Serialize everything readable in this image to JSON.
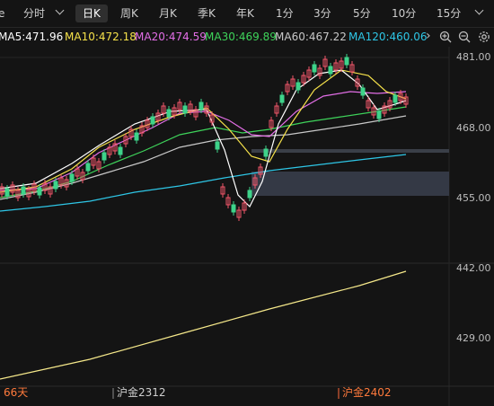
{
  "tabs": {
    "partial": "e",
    "items": [
      "分时",
      "日K",
      "周K",
      "月K",
      "季K",
      "年K",
      "1分",
      "3分",
      "5分",
      "10分",
      "15分"
    ],
    "active": "日K"
  },
  "legend": [
    {
      "label": "MA5:471.96",
      "color": "#ffffff"
    },
    {
      "label": "MA10:472.18",
      "color": "#f5e14a"
    },
    {
      "label": "MA20:474.59",
      "color": "#e26ee6"
    },
    {
      "label": "MA30:469.89",
      "color": "#3ed35a"
    },
    {
      "label": "MA60:467.22",
      "color": "#c8c8c8"
    },
    {
      "label": "MA120:460.06",
      "color": "#2ec6e6"
    }
  ],
  "icons": [
    "chevron-right-icon",
    "zoom-in-icon",
    "zoom-out-icon",
    "settings-icon"
  ],
  "price_axis": [
    "481.00",
    "468.00",
    "455.00",
    "442.00",
    "429.00"
  ],
  "bottom": {
    "left_label": "66天",
    "contract1": "沪金2312",
    "contract2": "沪金2402"
  },
  "colors": {
    "up": "#f2566a",
    "down": "#3ed38a",
    "ma5": "#ffffff",
    "ma10": "#f5e14a",
    "ma20": "#e26ee6",
    "ma30": "#3ed35a",
    "ma60": "#c8c8c8",
    "ma120": "#2ec6e6",
    "lower": "#f5e88a"
  }
}
